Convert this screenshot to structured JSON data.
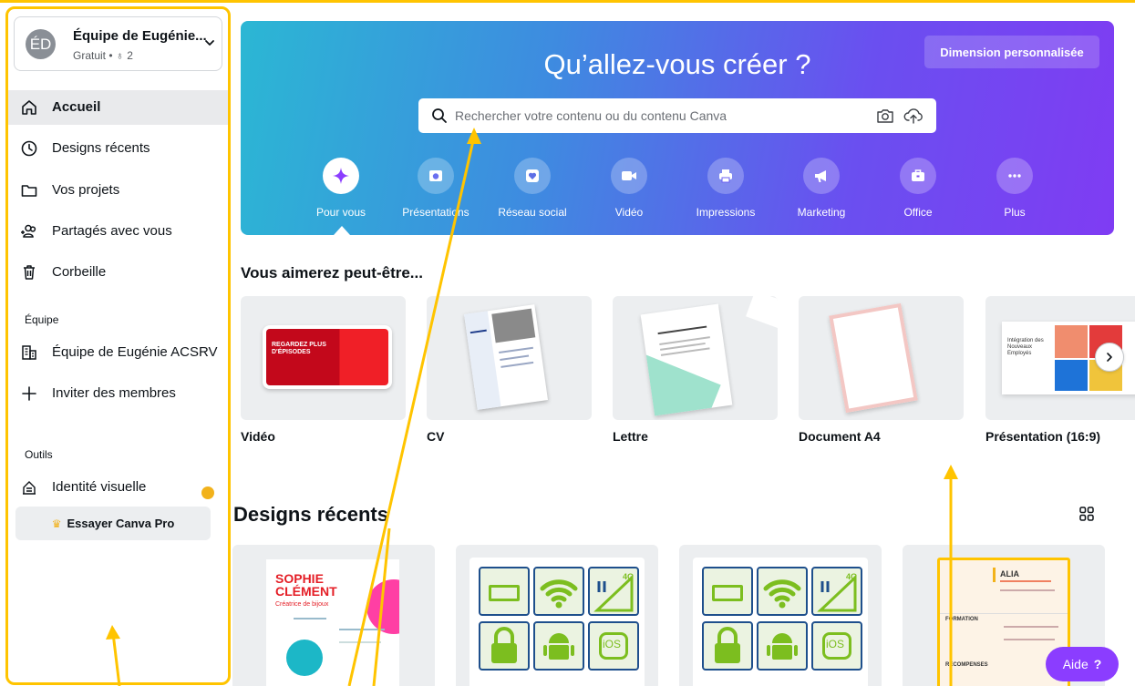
{
  "team": {
    "initials": "ÉD",
    "name": "Équipe de Eugénie...",
    "plan": "Gratuit • ♁ 2"
  },
  "nav": {
    "home": "Accueil",
    "recent": "Designs récents",
    "projects": "Vos projets",
    "shared": "Partagés avec vous",
    "trash": "Corbeille"
  },
  "team_section": {
    "title": "Équipe",
    "team_item": "Équipe de Eugénie ACSRV",
    "invite": "Inviter des membres"
  },
  "tools_section": {
    "title": "Outils",
    "brand_kit": "Identité visuelle",
    "try_pro": "Essayer Canva Pro"
  },
  "hero": {
    "title": "Qu’allez-vous créer ?",
    "custom_size": "Dimension personnalisée",
    "search_placeholder": "Rechercher votre contenu ou du contenu Canva",
    "categories": [
      "Pour vous",
      "Présentations",
      "Réseau social",
      "Vidéo",
      "Impressions",
      "Marketing",
      "Office",
      "Plus"
    ]
  },
  "suggestions": {
    "title": "Vous aimerez peut-être...",
    "items": [
      "Vidéo",
      "CV",
      "Lettre",
      "Document A4",
      "Présentation (16:9)"
    ],
    "video_thumb_text": "REGARDEZ PLUS D'ÉPISODES",
    "presentation_thumb_text": "Intégration des Nouveaux Employés"
  },
  "recent": {
    "title": "Designs récents",
    "cv_name": "SOPHIE CLÉMENT",
    "cv_role": "Créatrice de bijoux",
    "resume_name": "ALIA",
    "resume_section1": "FORMATION",
    "resume_section2": "RÉCOMPENSES",
    "ios_label": "iOS",
    "signal_label": "4G"
  },
  "help": {
    "label": "Aide",
    "icon": "?"
  },
  "colors": {
    "accent": "#8b3dff",
    "highlight": "#ffc400",
    "hero_start": "#2bb7d4",
    "hero_end": "#7f3cf3"
  }
}
